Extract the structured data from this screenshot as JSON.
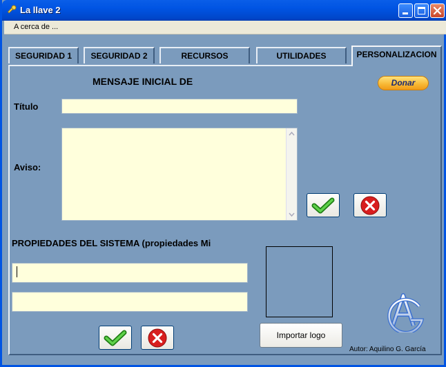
{
  "window": {
    "title": "La llave 2"
  },
  "menu": {
    "about": "A cerca de ..."
  },
  "tabs": [
    {
      "label": "SEGURIDAD 1"
    },
    {
      "label": "SEGURIDAD 2"
    },
    {
      "label": "RECURSOS"
    },
    {
      "label": "UTILIDADES"
    },
    {
      "label": "PERSONALIZACION",
      "active": true
    }
  ],
  "mensaje": {
    "heading": "MENSAJE INICIAL DE",
    "titulo_label": "Título",
    "titulo_value": "",
    "aviso_label": "Aviso:",
    "aviso_value": ""
  },
  "donar_label": "Donar",
  "propiedades": {
    "heading": "PROPIEDADES DEL SISTEMA (propiedades Mi",
    "field1_value": "",
    "field2_value": ""
  },
  "logo": {
    "import_label": "Importar logo"
  },
  "author": "Autor: Aquilino G. García",
  "colors": {
    "accent_ok": "#2e9b1f",
    "accent_cancel": "#d81e1e",
    "field_bg": "#ffffdc",
    "panel_bg": "#7b9bbd"
  }
}
